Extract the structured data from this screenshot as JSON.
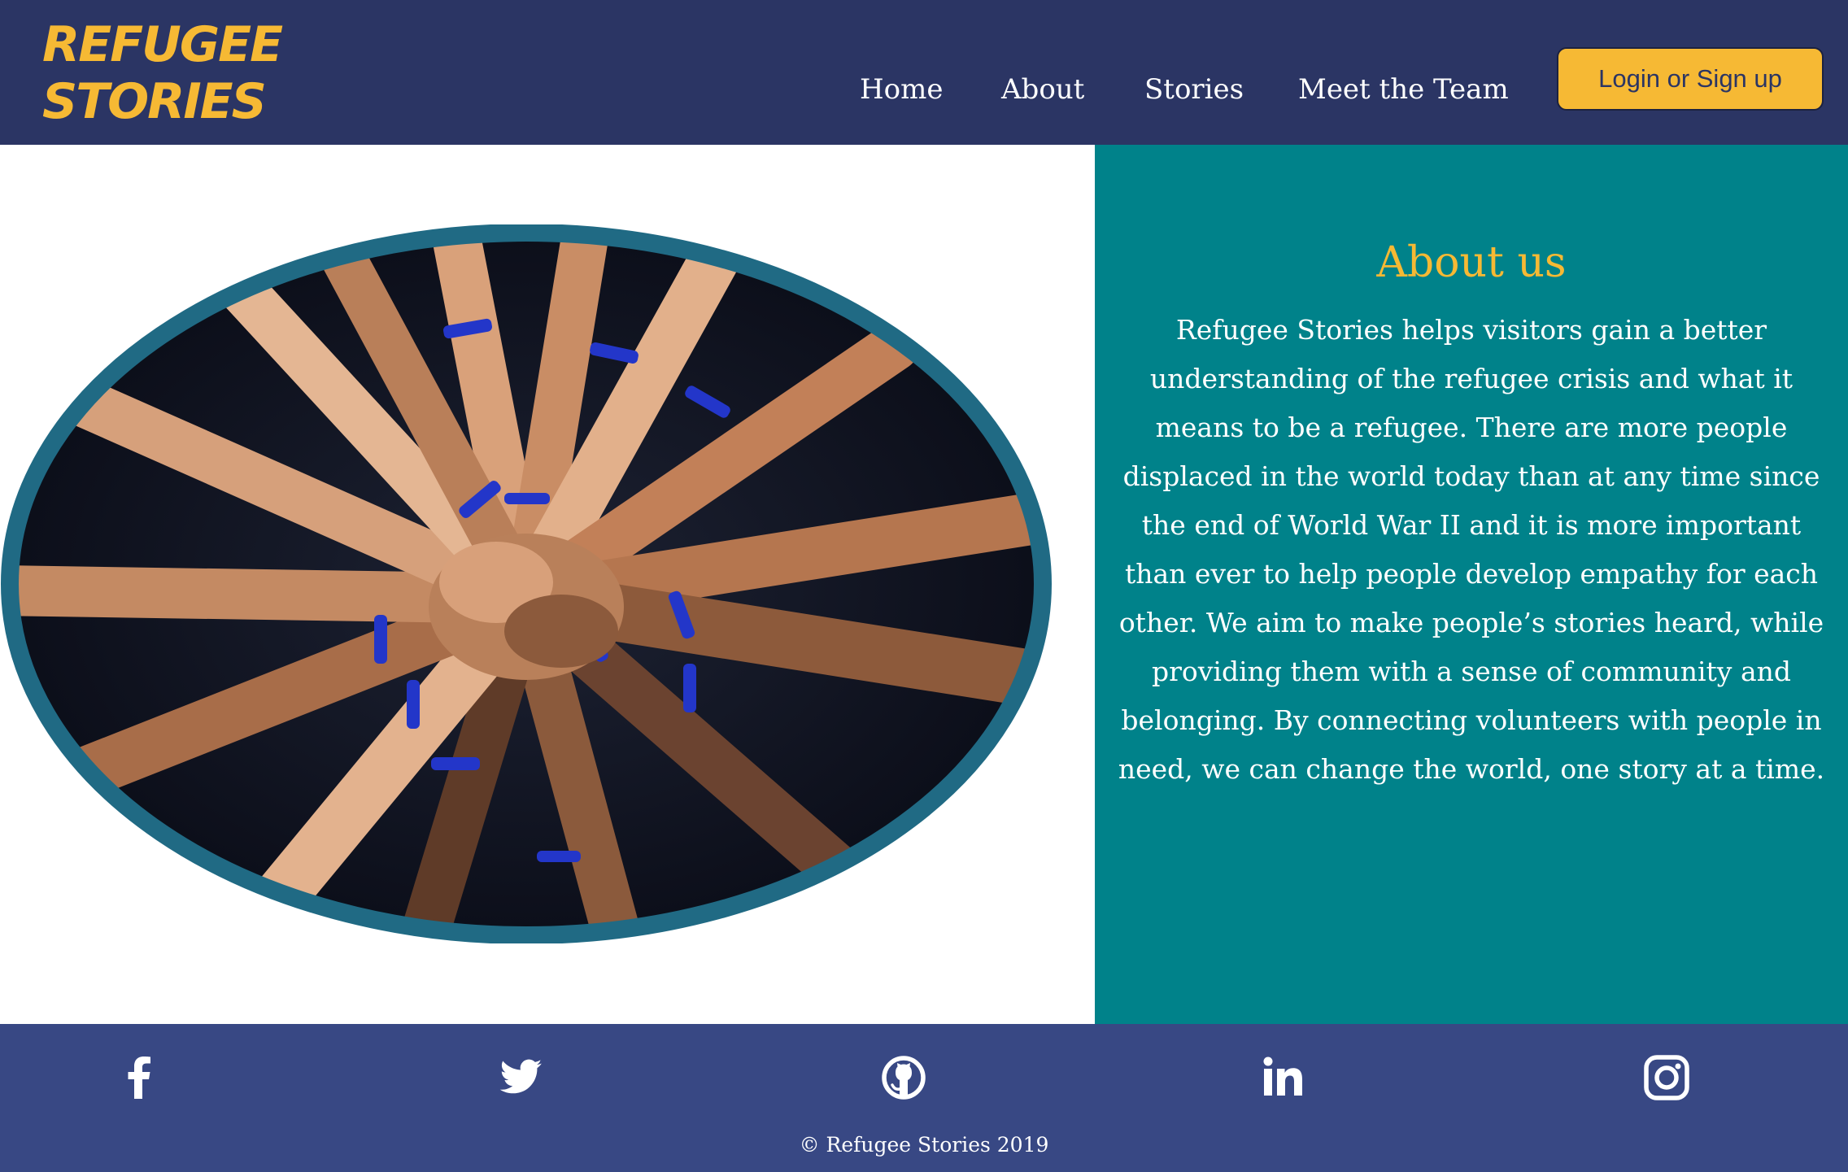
{
  "header": {
    "logo_line1": "REFUGEE",
    "logo_line2": "STORIES",
    "nav": [
      "Home",
      "About",
      "Stories",
      "Meet the Team"
    ],
    "login_label": "Login or Sign up"
  },
  "about": {
    "title": "About us",
    "body": "Refugee Stories helps visitors gain a better understanding of the refugee crisis and what it means to be a refugee. There are more people displaced in the world today than at any time since the end of World War II and it is more important than ever to help people develop empathy for each other. We aim to make people’s stories heard, while providing them with a sense of community and belonging. By connecting volunteers with people in need, we can change the world, one story at a time."
  },
  "footer": {
    "social_icons": [
      "facebook-icon",
      "twitter-icon",
      "github-icon",
      "linkedin-icon",
      "instagram-icon"
    ],
    "copyright": "© Refugee Stories 2019"
  },
  "colors": {
    "header_bg": "#2b3564",
    "accent_yellow": "#f6b934",
    "teal": "#00828a",
    "footer_bg": "#384884",
    "image_frame": "#206a84"
  }
}
